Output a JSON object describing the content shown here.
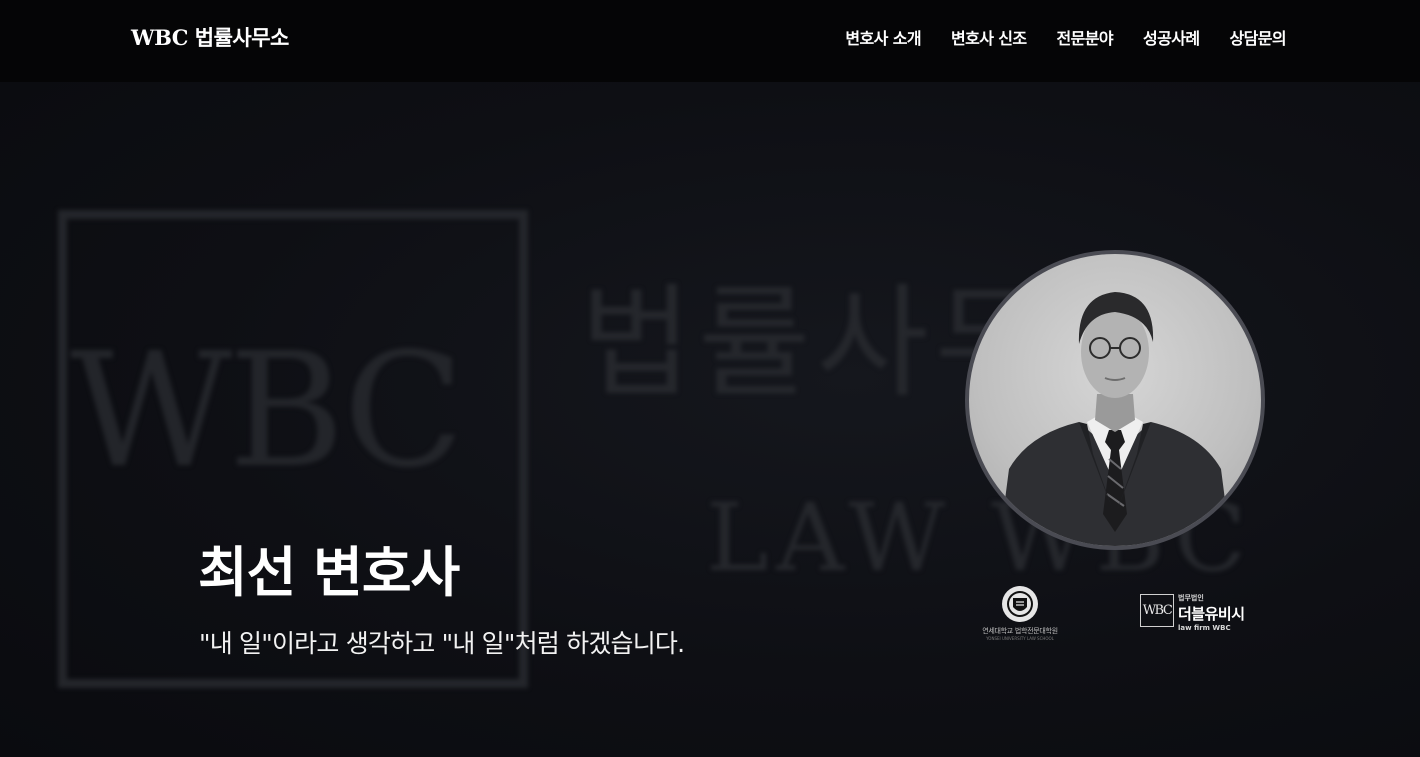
{
  "header": {
    "brand": "WBC 법률사무소",
    "nav": [
      {
        "label": "변호사 소개"
      },
      {
        "label": "변호사 신조"
      },
      {
        "label": "전문분야"
      },
      {
        "label": "성공사례"
      },
      {
        "label": "상담문의"
      }
    ]
  },
  "background": {
    "logo_letters": "WBC",
    "logo_korean": "법률사무소",
    "logo_english": "LAW WBC"
  },
  "hero": {
    "title": "최선 변호사",
    "subtitle": "\"내 일\"이라고 생각하고 \"내 일\"처럼 하겠습니다."
  },
  "affiliations": {
    "yonsei": {
      "name_korean": "연세대학교 법학전문대학원",
      "name_english": "YONSEI UNIVERSITY LAW SCHOOL"
    },
    "wbc": {
      "mark": "WBC",
      "small_label": "법무법인",
      "name": "더블유비시",
      "english": "law firm WBC"
    }
  },
  "colors": {
    "header_bg": "#050506",
    "page_bg": "#0d0e13",
    "text": "#ffffff"
  },
  "icons": {
    "portrait": "lawyer-portrait",
    "yonsei_seal": "university-seal-icon"
  }
}
